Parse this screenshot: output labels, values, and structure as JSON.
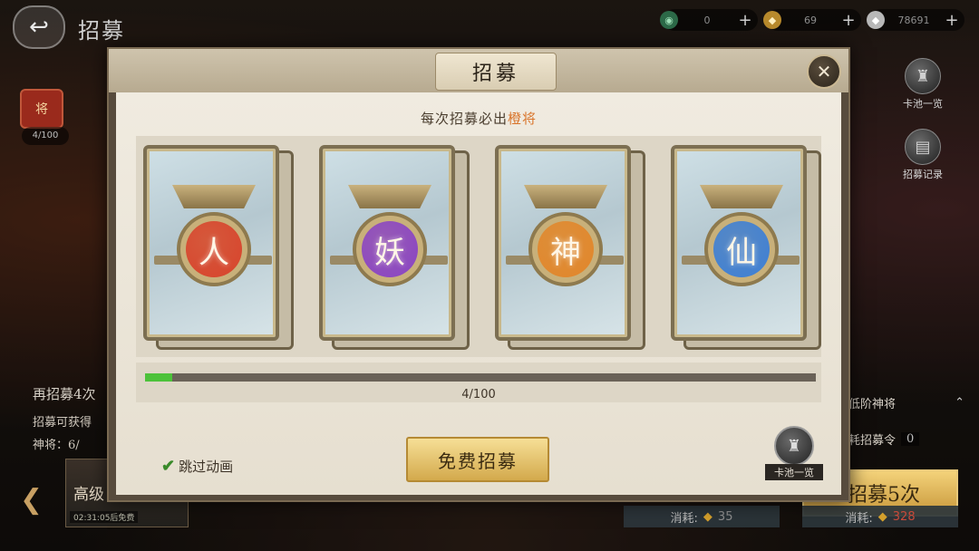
{
  "top_bar": {
    "title": "招募",
    "resources": [
      {
        "icon": "jade-icon",
        "value": "0"
      },
      {
        "icon": "gold-token-icon",
        "value": "69"
      },
      {
        "icon": "silver-token-icon",
        "value": "78691"
      }
    ]
  },
  "side_buttons": {
    "card_pool": "卡池一览",
    "recruit_record": "招募记录"
  },
  "left_panel": {
    "chip_label": "将",
    "progress": "4/100",
    "info_line1": "再招募4次",
    "info_line2": "招募可获得",
    "info_line3": "神将：6/",
    "card_title": "高级",
    "card_timer": "02:31:05后免费"
  },
  "right_panel": {
    "filter_label": "低阶神将",
    "cost_label": "耗招募令",
    "cost_count": "0",
    "recruit5_label": "招募5次"
  },
  "cost_bars": [
    {
      "label": "消耗:",
      "value": "35",
      "color": "normal"
    },
    {
      "label": "消耗:",
      "value": "328",
      "color": "red"
    }
  ],
  "dialog": {
    "title": "招募",
    "subtitle_prefix": "每次招募必出",
    "subtitle_highlight": "橙将",
    "cards": [
      {
        "glyph": "人",
        "color": "#d8432c"
      },
      {
        "glyph": "妖",
        "color": "#8a44c4"
      },
      {
        "glyph": "神",
        "color": "#e2862a"
      },
      {
        "glyph": "仙",
        "color": "#3c7fd6"
      }
    ],
    "progress_value": 4,
    "progress_max": 100,
    "progress_text": "4/100",
    "skip_label": "跳过动画",
    "free_button": "免费招募",
    "pool_button": "卡池一览"
  }
}
